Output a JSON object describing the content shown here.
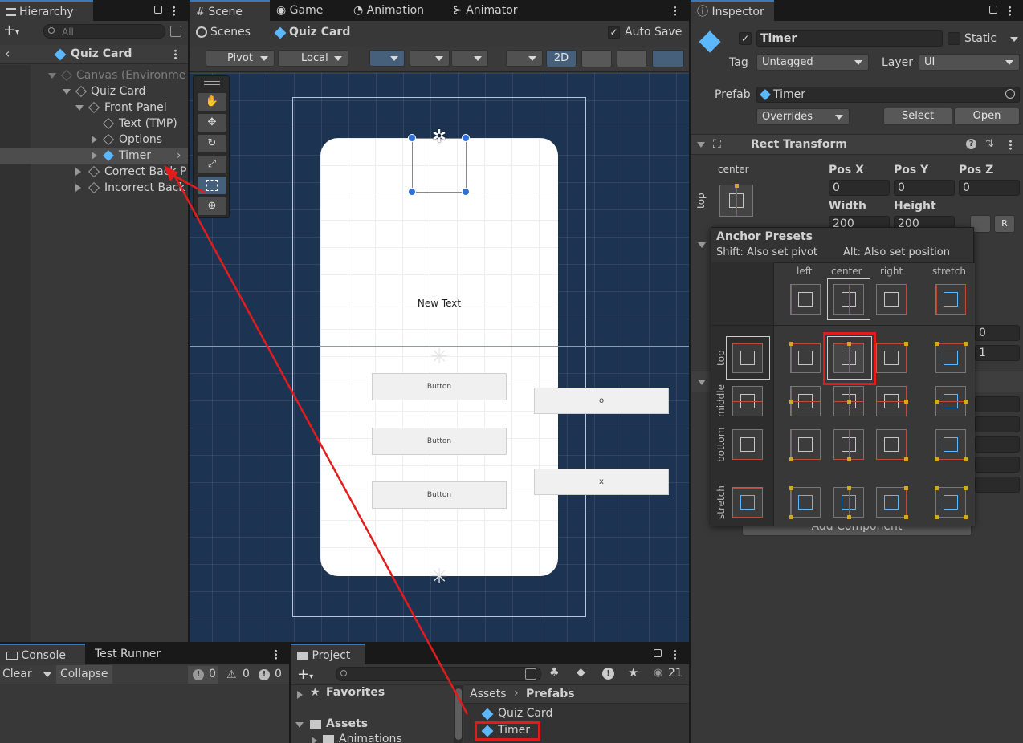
{
  "hierarchy": {
    "tab": "Hierarchy",
    "search_placeholder": "All",
    "breadcrumb": "Quiz Card",
    "items": [
      "Canvas (Environme",
      "Quiz Card",
      "Front Panel",
      "Text (TMP)",
      "Options",
      "Timer",
      "Correct Back P",
      "Incorrect Back"
    ]
  },
  "scene": {
    "tabs": [
      "Scene",
      "Game",
      "Animation",
      "Animator"
    ],
    "breadcrumb_root": "Scenes",
    "breadcrumb_current": "Quiz Card",
    "autosave_label": "Auto Save",
    "pivot_label": "Pivot",
    "local_label": "Local",
    "mode_2d_label": "2D",
    "card_text": "New Text",
    "buttons": [
      "Button",
      "Button",
      "Button"
    ],
    "side_labels": [
      "o",
      "x"
    ]
  },
  "inspector": {
    "tab": "Inspector",
    "object_name": "Timer",
    "static_label": "Static",
    "tag_label": "Tag",
    "tag_value": "Untagged",
    "layer_label": "Layer",
    "layer_value": "UI",
    "prefab_label": "Prefab",
    "prefab_value": "Timer",
    "overrides_label": "Overrides",
    "select_label": "Select",
    "open_label": "Open",
    "rect_title": "Rect Transform",
    "anchor_h": "center",
    "anchor_v": "top",
    "pos_x_label": "Pos X",
    "pos_y_label": "Pos Y",
    "pos_z_label": "Pos Z",
    "pos_x": "0",
    "pos_y": "0",
    "pos_z": "0",
    "width_label": "Width",
    "height_label": "Height",
    "width": "200",
    "height": "200",
    "hidden_value_1": "0",
    "hidden_value_2": "1",
    "add_component": "Add Component"
  },
  "anchor_presets": {
    "title": "Anchor Presets",
    "shift_hint": "Shift: Also set pivot",
    "alt_hint": "Alt: Also set position",
    "columns": [
      "left",
      "center",
      "right",
      "stretch"
    ],
    "rows": [
      "top",
      "middle",
      "bottom",
      "stretch"
    ]
  },
  "console": {
    "tabs": [
      "Console",
      "Test Runner"
    ],
    "clear_label": "Clear",
    "collapse_label": "Collapse",
    "log_count": "0",
    "warn_count": "0",
    "error_count": "0"
  },
  "project": {
    "tab": "Project",
    "favorites": "Favorites",
    "assets": "Assets",
    "animations": "Animations",
    "path": [
      "Assets",
      "Prefabs"
    ],
    "files": [
      "Quiz Card",
      "Timer"
    ],
    "hidden_count": "21"
  },
  "colors": {
    "accent": "#3a79bb",
    "scene_bg": "#1d3352",
    "highlight_red": "#e21c1c",
    "prefab_blue": "#5bb8ff"
  }
}
